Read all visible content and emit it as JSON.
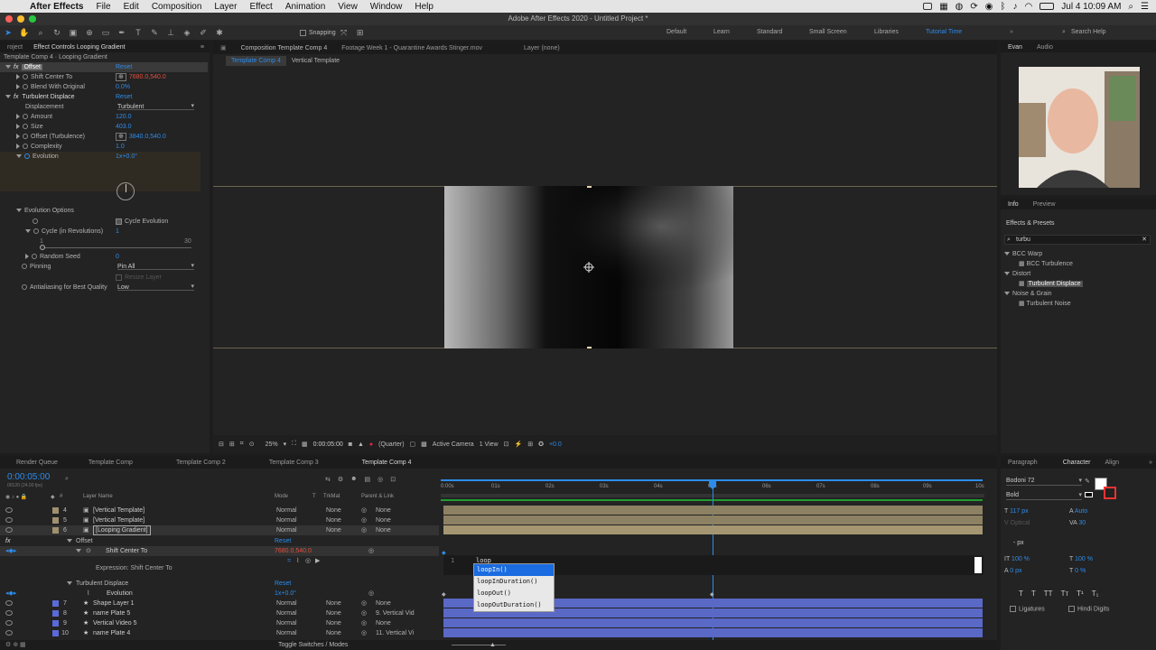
{
  "menubar": {
    "app": "After Effects",
    "items": [
      "File",
      "Edit",
      "Composition",
      "Layer",
      "Effect",
      "Animation",
      "View",
      "Window",
      "Help"
    ],
    "clock": "Jul 4  10:09 AM",
    "search": "Search Help"
  },
  "window_title": "Adobe After Effects 2020 - Untitled Project *",
  "toolbar": {
    "snapping": "Snapping",
    "workspaces": [
      "Default",
      "Learn",
      "Standard",
      "Small Screen",
      "Libraries",
      "Tutorial Time"
    ],
    "search_help": "Search Help"
  },
  "left_panel": {
    "tabs": [
      "roject",
      "Effect Controls Looping Gradient"
    ],
    "header": "Template Comp 4 · Looping Gradient",
    "offset": {
      "name": "Offset",
      "reset": "Reset"
    },
    "shift_center": {
      "label": "Shift Center To",
      "value": "7680.0,540.0"
    },
    "blend": {
      "label": "Blend With Original",
      "value": "0.0%"
    },
    "turbulent": {
      "name": "Turbulent Displace",
      "reset": "Reset"
    },
    "displacement": {
      "label": "Displacement",
      "value": "Turbulent"
    },
    "amount": {
      "label": "Amount",
      "value": "120.0"
    },
    "size": {
      "label": "Size",
      "value": "403.0"
    },
    "offset_turb": {
      "label": "Offset (Turbulence)",
      "value": "3840.0,540.0"
    },
    "complexity": {
      "label": "Complexity",
      "value": "1.0"
    },
    "evolution": {
      "label": "Evolution",
      "value": "1x+0.0°"
    },
    "evolution_options": "Evolution Options",
    "cycle_evolution": "Cycle Evolution",
    "cycle_revs": {
      "label": "Cycle (in Revolutions)",
      "value": "1",
      "min": "1",
      "max": "30"
    },
    "random_seed": {
      "label": "Random Seed",
      "value": "0"
    },
    "pinning": {
      "label": "Pinning",
      "value": "Pin All"
    },
    "resize_layer": "Resize Layer",
    "antialias": {
      "label": "Antialiasing for Best Quality",
      "value": "Low"
    }
  },
  "viewer": {
    "tabs": [
      "Composition Template Comp 4",
      "Footage Week 1 - Quarantine Awards Stinger.mov",
      "Layer (none)"
    ],
    "subtabs": [
      "Template Comp 4",
      "Vertical Template"
    ],
    "zoom": "25%",
    "timecode": "0:00:05:00",
    "resolution": "(Quarter)",
    "camera": "Active Camera",
    "views": "1 View",
    "exposure": "+0.0"
  },
  "right_panel": {
    "tabs": [
      "Evan",
      "Audio"
    ],
    "info_tabs": [
      "Info",
      "Preview"
    ],
    "effects_title": "Effects & Presets",
    "search": "turbu",
    "groups": [
      {
        "name": "BCC Warp",
        "items": [
          "BCC Turbulence"
        ]
      },
      {
        "name": "Distort",
        "items": [
          "Turbulent Displace"
        ]
      },
      {
        "name": "Noise & Grain",
        "items": [
          "Turbulent Noise"
        ]
      }
    ]
  },
  "timeline": {
    "tabs": [
      "Render Queue",
      "Template Comp",
      "Template Comp 2",
      "Template Comp 3",
      "Template Comp 4"
    ],
    "timecode": "0:00:05:00",
    "frames": "00120 (24.00 fps)",
    "columns": {
      "layer_name": "Layer Name",
      "mode": "Mode",
      "t": "T",
      "trkmat": "TrkMat",
      "parent": "Parent & Link"
    },
    "ruler": [
      "0:00s",
      "01s",
      "02s",
      "03s",
      "04s",
      "05s",
      "06s",
      "07s",
      "08s",
      "09s",
      "10s"
    ],
    "layers_top": [
      {
        "num": "4",
        "name": "[Vertical Template]",
        "mode": "Normal",
        "trk": "None",
        "parent": "None"
      },
      {
        "num": "5",
        "name": "[Vertical Template]",
        "mode": "Normal",
        "trk": "None",
        "parent": "None"
      },
      {
        "num": "6",
        "name": "[Looping Gradient]",
        "mode": "Normal",
        "trk": "None",
        "parent": "None"
      }
    ],
    "offset": "Offset",
    "offset_reset": "Reset",
    "shift_center": "Shift Center To",
    "shift_center_value": "7680.0,540.0",
    "expression_label": "Expression: Shift Center To",
    "expr_line": "1",
    "expr_text": "loop",
    "turbulent": "Turbulent Displace",
    "turbulent_reset": "Reset",
    "evolution": "Evolution",
    "evolution_value": "1x+0.0°",
    "layers_bottom": [
      {
        "num": "7",
        "name": "Shape Layer 1",
        "mode": "Normal",
        "trk": "None",
        "parent": "None"
      },
      {
        "num": "8",
        "name": "name Plate 5",
        "mode": "Normal",
        "trk": "None",
        "parent": "9. Vertical Vid"
      },
      {
        "num": "9",
        "name": "Vertical Video 5",
        "mode": "Normal",
        "trk": "None",
        "parent": "None"
      },
      {
        "num": "10",
        "name": "name Plate 4",
        "mode": "Normal",
        "trk": "None",
        "parent": "11. Vertical Vi"
      }
    ],
    "toggle": "Toggle Switches / Modes",
    "autocomplete": [
      "loopIn()",
      "loopInDuration()",
      "loopOut()",
      "loopOutDuration()"
    ]
  },
  "character": {
    "tabs": [
      "Paragraph",
      "Character",
      "Align"
    ],
    "font": "Bodoni 72",
    "style": "Bold",
    "size": "117 px",
    "leading": "Auto",
    "kerning": "Optical",
    "tracking": "30",
    "stroke": "- px",
    "vscale": "100 %",
    "hscale": "100 %",
    "baseline": "0 px",
    "tsume": "0 %",
    "ligatures": "Ligatures",
    "hindi": "Hindi Digits"
  }
}
